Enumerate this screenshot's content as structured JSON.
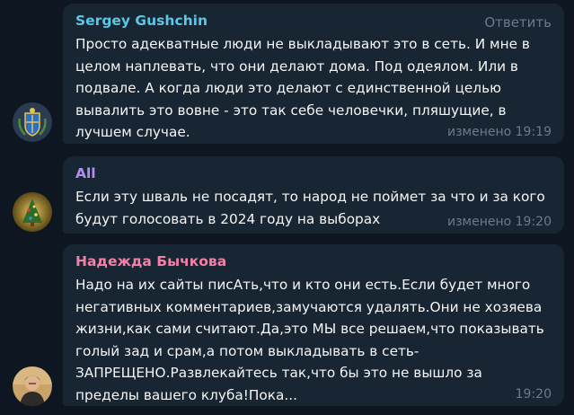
{
  "colors": {
    "background": "#0e1621",
    "bubble": "#182533",
    "meta": "#6b7a8c"
  },
  "messages": [
    {
      "author": "Sergey Gushchin",
      "author_color": "#5bc8e6",
      "reply_label": "Ответить",
      "text": "Просто адекватные люди не выкладывают это в сеть. И мне в\nцелом наплевать, что они делают дома. Под одеялом. Или в\nподвале. А когда люди это делают с единственной целью\nвывалить это вовне - это так себе человечки, пляшущие, в\nлучшем случае.",
      "edited_label": "изменено",
      "time": "19:19"
    },
    {
      "author": "All",
      "author_color": "#b28ef0",
      "text": "Если эту шваль не посадят, то народ не поймет за что и за кого\nбудут голосовать в 2024 году на выборах",
      "edited_label": "изменено",
      "time": "19:20"
    },
    {
      "author": "Надежда Бычкова",
      "author_color": "#f57fa6",
      "text": "Надо на их сайты писАть,что и кто они есть.Если будет много\nнегативных комментариев,замучаются удалять.Они не хозяева\nжизни,как сами считают.Да,это МЫ все решаем,что показывать\nголый зад и срам,а потом выкладывать в сеть-\nЗАПРЕЩЕНО.Развлекайтесь так,что бы это не вышло за\nпределы вашего клуба!Пока...",
      "time": "19:20"
    }
  ]
}
